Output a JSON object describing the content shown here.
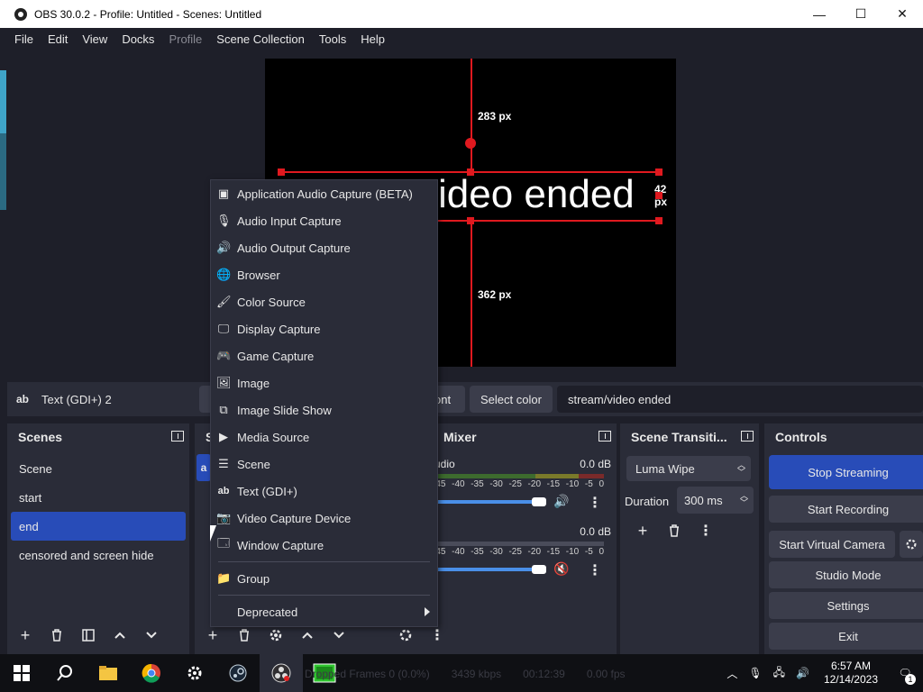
{
  "window": {
    "title": "OBS 30.0.2 - Profile: Untitled - Scenes: Untitled",
    "minimize": "—",
    "maximize": "☐",
    "close": "✕"
  },
  "menu": [
    "File",
    "Edit",
    "View",
    "Docks",
    "Profile",
    "Scene Collection",
    "Tools",
    "Help"
  ],
  "canvas": {
    "text": "video ended",
    "dist_top": "283 px",
    "dist_right": "42 px",
    "dist_bottom": "362 px"
  },
  "source_bar": {
    "icon": "ab",
    "source_name": "Text (GDI+) 2",
    "font_button": "ont",
    "color_button": "Select color",
    "text_value": "stream/video ended"
  },
  "scenes": {
    "title": "Scenes",
    "items": [
      "Scene",
      "start",
      "end",
      "censored and screen hide"
    ],
    "active_index": 2
  },
  "sources": {
    "title_partial": "S",
    "item_partial": "a"
  },
  "mixer": {
    "title": "Mixer",
    "tracks": [
      {
        "name": "udio",
        "level": "0.0 dB",
        "muted": false
      },
      {
        "name": "",
        "level": "0.0 dB",
        "muted": true
      }
    ],
    "ticks": [
      "-45",
      "-40",
      "-35",
      "-30",
      "-25",
      "-20",
      "-15",
      "-10",
      "-5",
      "0"
    ]
  },
  "transitions": {
    "title": "Scene Transiti...",
    "selected": "Luma Wipe",
    "duration_label": "Duration",
    "duration_value": "300 ms"
  },
  "controls": {
    "title": "Controls",
    "stop_streaming": "Stop Streaming",
    "start_recording": "Start Recording",
    "start_virtual_camera": "Start Virtual Camera",
    "studio_mode": "Studio Mode",
    "settings": "Settings",
    "exit": "Exit"
  },
  "context_menu": {
    "items": [
      {
        "label": "Application Audio Capture (BETA)",
        "icon": "app-audio-icon"
      },
      {
        "label": "Audio Input Capture",
        "icon": "microphone-icon"
      },
      {
        "label": "Audio Output Capture",
        "icon": "speaker-icon"
      },
      {
        "label": "Browser",
        "icon": "globe-icon"
      },
      {
        "label": "Color Source",
        "icon": "brush-icon"
      },
      {
        "label": "Display Capture",
        "icon": "monitor-icon"
      },
      {
        "label": "Game Capture",
        "icon": "gamepad-icon"
      },
      {
        "label": "Image",
        "icon": "image-icon"
      },
      {
        "label": "Image Slide Show",
        "icon": "slideshow-icon"
      },
      {
        "label": "Media Source",
        "icon": "play-icon"
      },
      {
        "label": "Scene",
        "icon": "list-icon"
      },
      {
        "label": "Text (GDI+)",
        "icon": "text-icon"
      },
      {
        "label": "Video Capture Device",
        "icon": "camera-icon"
      },
      {
        "label": "Window Capture",
        "icon": "window-icon"
      }
    ],
    "group": "Group",
    "deprecated": "Deprecated"
  },
  "status": {
    "dropped": "Dropped Frames 0 (0.0%)",
    "bitrate": "3439 kbps",
    "time": "00:12:39",
    "cpu": "0.00 fps"
  },
  "taskbar": {
    "time": "6:57 AM",
    "date": "12/14/2023",
    "notifications": "1"
  }
}
